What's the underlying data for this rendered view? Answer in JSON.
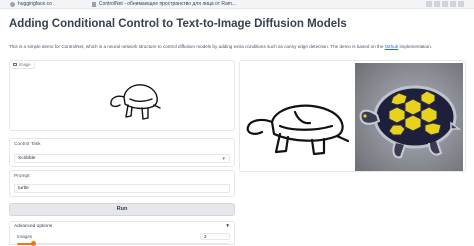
{
  "browser": {
    "host": "huggingface.co",
    "tab_title": "ControlNet - обнимающее пространство для лица от Ram..."
  },
  "page": {
    "title": "Adding Conditional Control to Text-to-Image Diffusion Models",
    "description_prefix": "This is a simple demo for ControlNet, which is a neural network structure to control diffusion models by adding extra conditions such as canny edge detection. The demo is based on the ",
    "description_link": "Github",
    "description_suffix": " implementation."
  },
  "image_input": {
    "label": "Image"
  },
  "control_task": {
    "label": "Control Task",
    "value": "Scribble"
  },
  "prompt": {
    "label": "Prompt",
    "value": "turtle"
  },
  "run": {
    "label": "Run"
  },
  "advanced": {
    "label": "Advanced options",
    "images_label": "Images",
    "images_value": "2",
    "images_fraction": 0.08
  },
  "colors": {
    "accent": "#f97316",
    "link": "#2563eb"
  },
  "icons": {
    "image_chip": "image-icon",
    "dropdown": "chevron-down-icon",
    "accordion": "triangle-down-icon"
  }
}
